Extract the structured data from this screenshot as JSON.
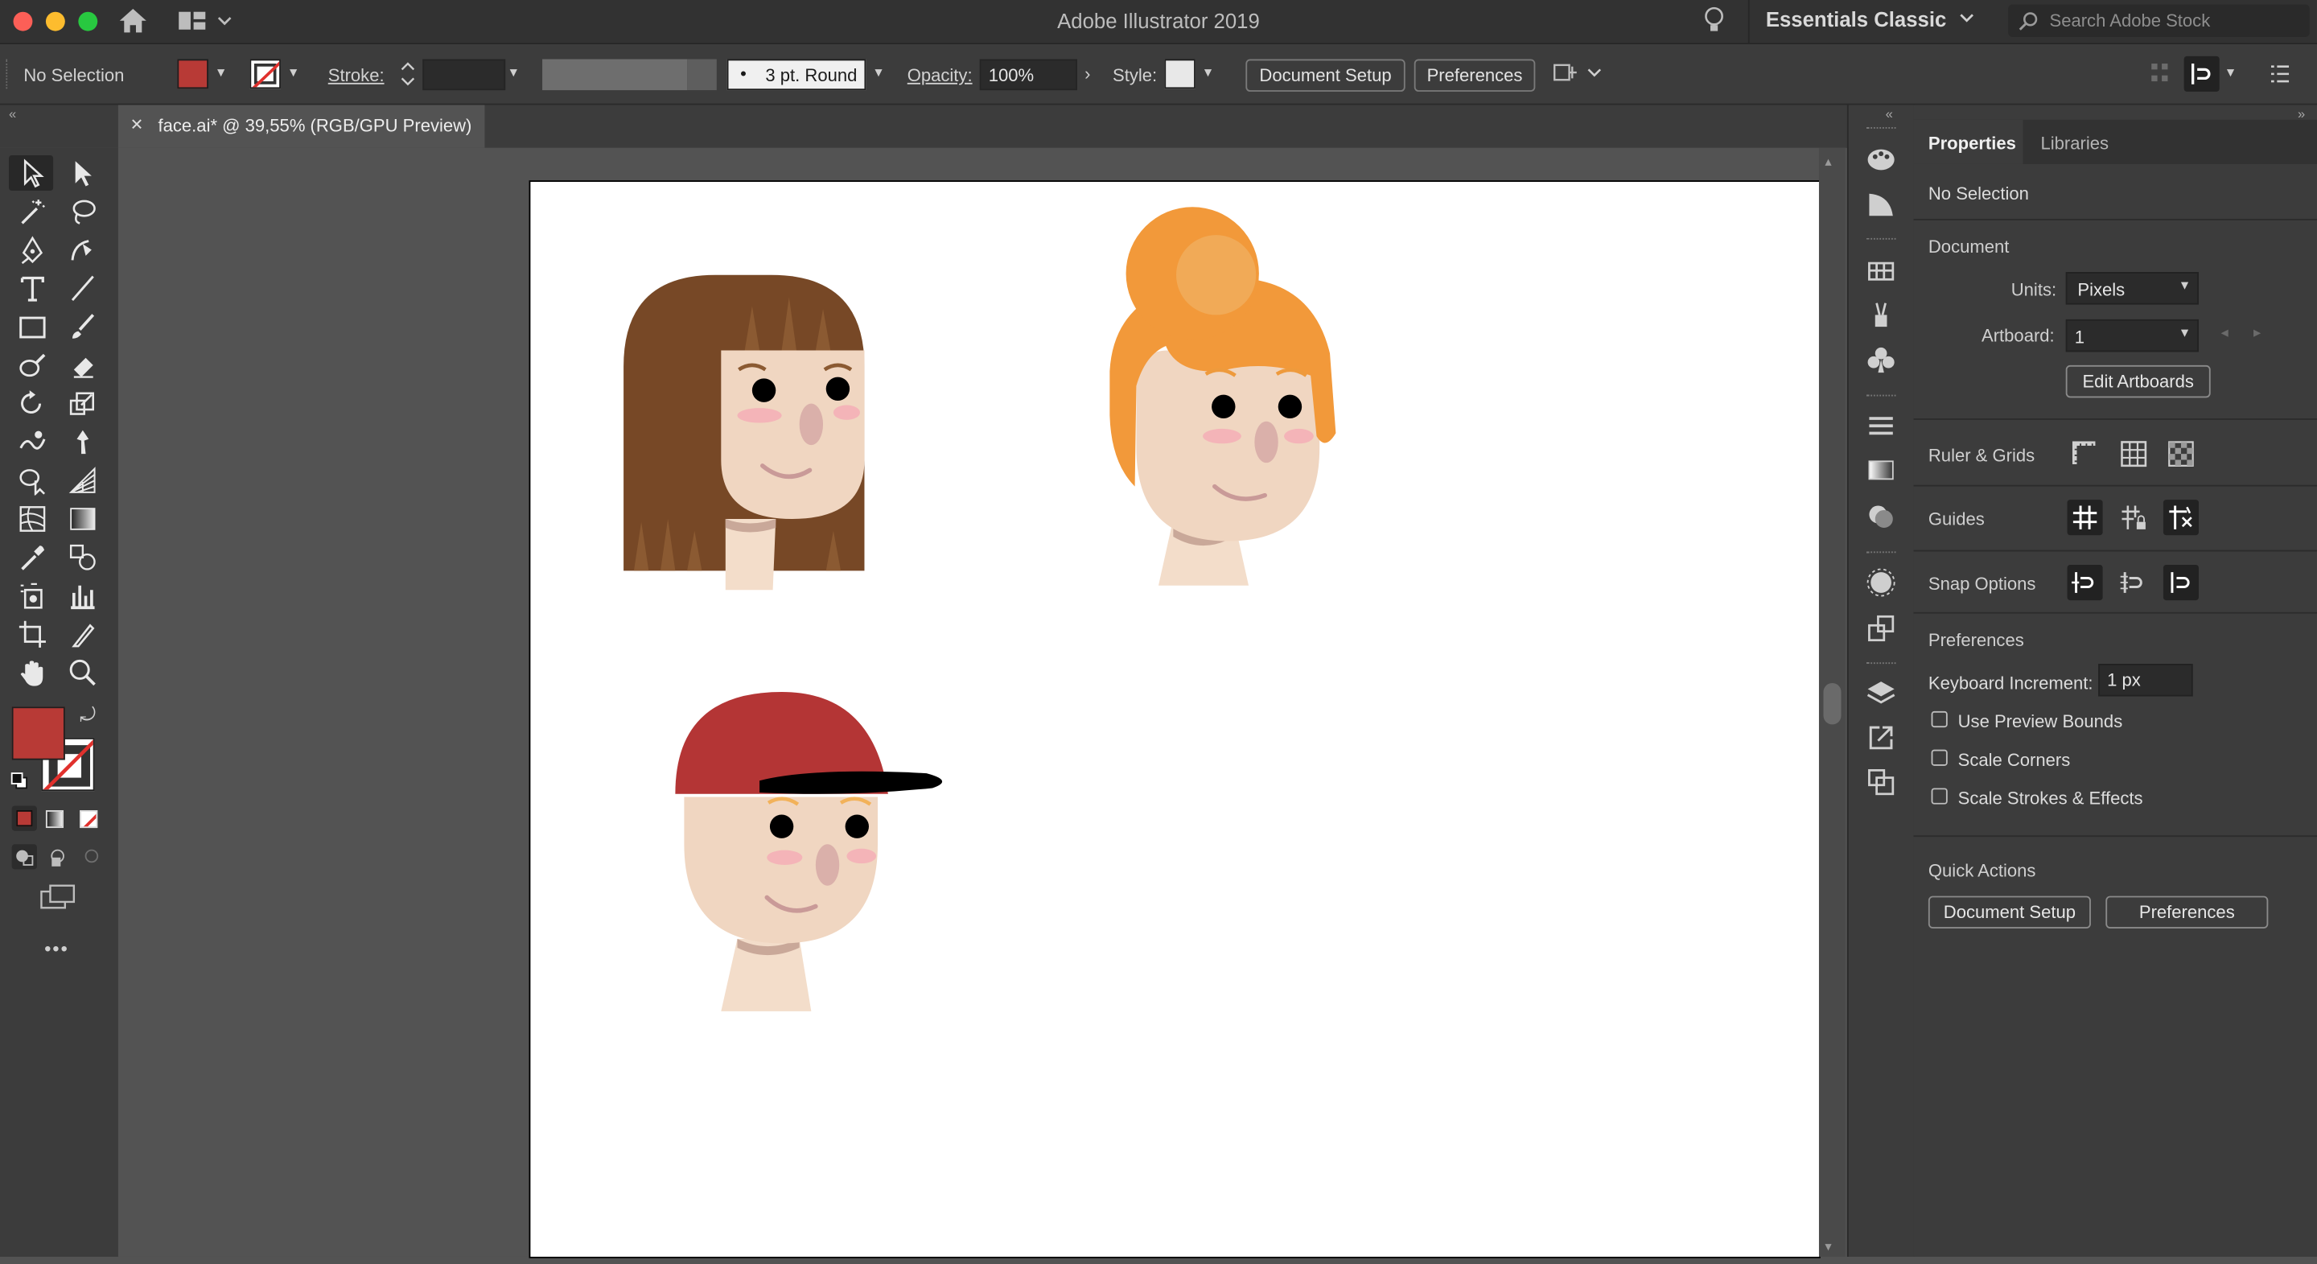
{
  "app": {
    "title": "Adobe Illustrator 2019",
    "workspace": "Essentials Classic",
    "search_placeholder": "Search Adobe Stock"
  },
  "control_bar": {
    "selection_label": "No Selection",
    "stroke_label": "Stroke:",
    "brush_value": "3 pt. Round",
    "opacity_label": "Opacity:",
    "opacity_value": "100%",
    "style_label": "Style:",
    "document_setup_button": "Document Setup",
    "preferences_button": "Preferences",
    "fill_color": "#b83a36"
  },
  "document_tab": {
    "close_glyph": "✕",
    "title": "face.ai* @ 39,55% (RGB/GPU Preview)"
  },
  "toolbar": {
    "fill_color": "#b83a36",
    "more_glyph": "•••"
  },
  "properties_panel": {
    "tabs": [
      "Properties",
      "Libraries"
    ],
    "selection_status": "No Selection",
    "document_section": "Document",
    "units_label": "Units:",
    "units_value": "Pixels",
    "artboard_label": "Artboard:",
    "artboard_value": "1",
    "edit_artboards_button": "Edit Artboards",
    "ruler_grids_label": "Ruler & Grids",
    "guides_label": "Guides",
    "snap_options_label": "Snap Options",
    "preferences_section": "Preferences",
    "keyboard_increment_label": "Keyboard Increment:",
    "keyboard_increment_value": "1 px",
    "checkboxes": [
      "Use Preview Bounds",
      "Scale Corners",
      "Scale Strokes & Effects"
    ],
    "quick_actions_label": "Quick Actions",
    "document_setup_button": "Document Setup",
    "preferences_button": "Preferences"
  },
  "colors": {
    "brown_hair": "#774826",
    "orange_hair": "#f2993a",
    "cap_red": "#b43535",
    "skin": "#f0d6c1",
    "neck": "#f3ddca",
    "blush": "#f4b4b8",
    "nose": "#dab0aa"
  }
}
